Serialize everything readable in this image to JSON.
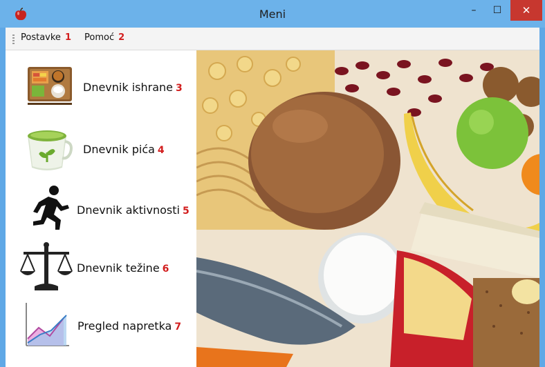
{
  "window": {
    "title": "Meni"
  },
  "titlebar_buttons": {
    "minimize": "–",
    "maximize": "☐",
    "close": "✕"
  },
  "menu": {
    "items": [
      {
        "label": "Postavke",
        "marker": "1"
      },
      {
        "label": "Pomoć",
        "marker": "2"
      }
    ]
  },
  "sidebar": {
    "items": [
      {
        "label": "Dnevnik ishrane",
        "marker": "3",
        "icon": "food-tray-icon"
      },
      {
        "label": "Dnevnik pića",
        "marker": "4",
        "icon": "tea-cup-icon"
      },
      {
        "label": "Dnevnik aktivnosti",
        "marker": "5",
        "icon": "running-person-icon"
      },
      {
        "label": "Dnevnik težine",
        "marker": "6",
        "icon": "scales-icon"
      },
      {
        "label": "Pregled napretka",
        "marker": "7",
        "icon": "progress-chart-icon"
      }
    ]
  },
  "colors": {
    "titlebar": "#6cb2ea",
    "close_button": "#c7372f",
    "marker": "#d21e1e"
  }
}
